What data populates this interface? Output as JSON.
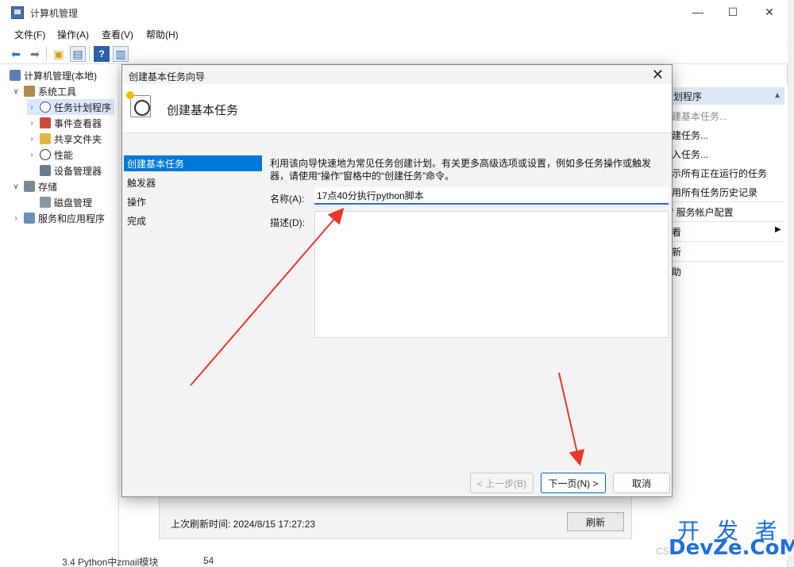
{
  "window": {
    "title": "计算机管理"
  },
  "menu": [
    "文件(F)",
    "操作(A)",
    "查看(V)",
    "帮助(H)"
  ],
  "tree": {
    "root": "计算机管理(本地)",
    "system_tools": "系统工具",
    "task_scheduler": "任务计划程序",
    "event_viewer": "事件查看器",
    "shared_folders": "共享文件夹",
    "performance": "性能",
    "device_manager": "设备管理器",
    "storage": "存储",
    "disk_management": "磁盘管理",
    "services_apps": "服务和应用程序"
  },
  "actions": {
    "header": "划程序",
    "items": [
      "建基本任务...",
      "建任务...",
      "入任务...",
      "示所有正在运行的任务",
      "用所有任务历史记录",
      "' 服务帐户配置",
      "看",
      "新",
      "助"
    ]
  },
  "dialog": {
    "title": "创建基本任务向导",
    "header_title": "创建基本任务",
    "nav": [
      "创建基本任务",
      "触发器",
      "操作",
      "完成"
    ],
    "description": "利用该向导快速地为常见任务创建计划。有关更多高级选项或设置，例如多任务操作或触发器，请使用“操作”窗格中的“创建任务”命令。",
    "name_label": "名称(A):",
    "name_value": "17点40分执行python脚本",
    "desc_label": "描述(D):",
    "back_button": "< 上一步(B)",
    "next_button": "下一页(N) >",
    "cancel_button": "取消"
  },
  "bottom": {
    "last_refresh": "上次刷新时间: 2024/8/15 17:27:23",
    "refresh_button": "刷新",
    "row_text": "3.4 Python中zmail模块",
    "row_num": "54"
  },
  "watermark": {
    "line1": "开 发 者",
    "line2": "DevZe.CoM",
    "csdn": "CS"
  }
}
